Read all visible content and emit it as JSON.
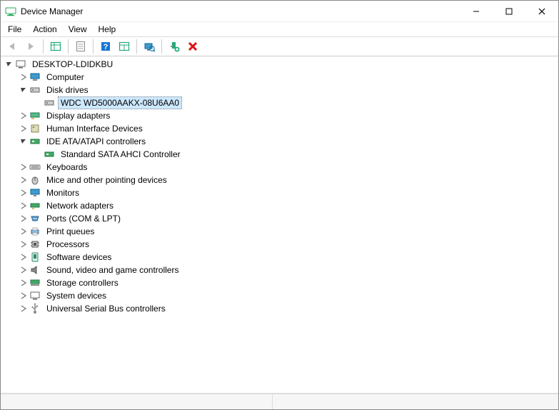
{
  "window": {
    "title": "Device Manager"
  },
  "menus": {
    "file": "File",
    "action": "Action",
    "view": "View",
    "help": "Help"
  },
  "root": {
    "name": "DESKTOP-LDIDKBU"
  },
  "cat": {
    "computer": "Computer",
    "disk_drives": "Disk drives",
    "disk0": "WDC WD5000AAKX-08U6AA0",
    "display": "Display adapters",
    "hid": "Human Interface Devices",
    "ide": "IDE ATA/ATAPI controllers",
    "ide0": "Standard SATA AHCI Controller",
    "keyboards": "Keyboards",
    "mice": "Mice and other pointing devices",
    "monitors": "Monitors",
    "network": "Network adapters",
    "ports": "Ports (COM & LPT)",
    "printq": "Print queues",
    "processors": "Processors",
    "software": "Software devices",
    "sound": "Sound, video and game controllers",
    "storage": "Storage controllers",
    "system": "System devices",
    "usb": "Universal Serial Bus controllers"
  }
}
